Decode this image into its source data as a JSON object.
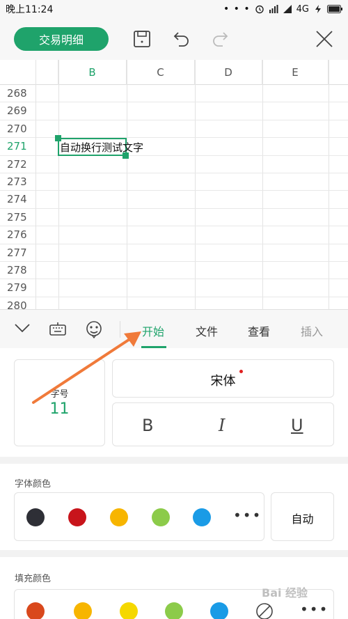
{
  "status_bar": {
    "time": "晚上11:24",
    "network": "4G",
    "dots": "• • •"
  },
  "toolbar": {
    "detail_button": "交易明细",
    "icons": [
      "save-icon",
      "undo-icon",
      "redo-icon",
      "close-icon"
    ]
  },
  "sheet": {
    "columns": [
      "B",
      "C",
      "D",
      "E"
    ],
    "selected_column": "B",
    "rows": [
      "268",
      "269",
      "270",
      "271",
      "272",
      "273",
      "274",
      "275",
      "276",
      "277",
      "278",
      "279",
      "280"
    ],
    "selected_row": "271",
    "cell_text": "自动换行测试文字"
  },
  "tabs": {
    "items": [
      "开始",
      "文件",
      "查看",
      "插入"
    ],
    "active": "开始"
  },
  "font_panel": {
    "size_label": "字号",
    "size_value": "11",
    "font_name": "宋体",
    "bold": "B",
    "italic": "I",
    "underline": "U"
  },
  "font_color": {
    "title": "字体颜色",
    "colors": [
      "#2e2f36",
      "#c8141b",
      "#f7b500",
      "#8ccb4a",
      "#1a9be6"
    ],
    "more": "•••",
    "auto_label": "自动"
  },
  "fill_color": {
    "title": "填充颜色",
    "colors": [
      "#d9481c",
      "#f7b500",
      "#f5d800",
      "#8ccb4a",
      "#1a9be6"
    ],
    "more": "•••"
  },
  "colors": {
    "accent": "#1fa36b",
    "arrow": "#f07a3a"
  },
  "watermark": "Bai 经验"
}
